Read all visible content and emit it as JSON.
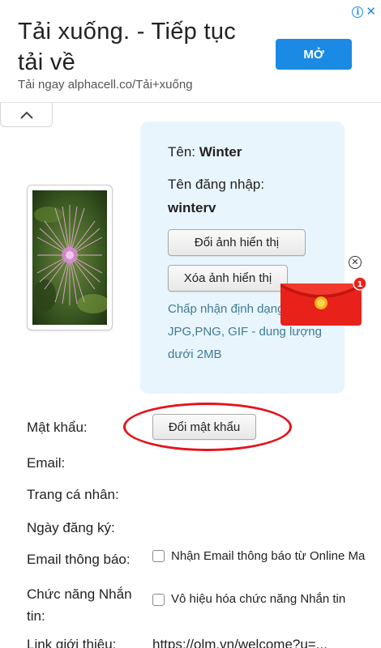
{
  "ad": {
    "title": "Tải xuống. - Tiếp tục tải về",
    "url": "Tải ngay alphacell.co/Tải+xuống",
    "button": "MỞ",
    "info_icon": "info-icon",
    "close_icon": "close-icon",
    "accent": "#1a8ae5"
  },
  "collapse": {
    "icon": "chevron-up-icon"
  },
  "profile": {
    "name_label": "Tên: ",
    "name_value": "Winter",
    "login_label": "Tên đăng nhập:",
    "login_value": "winterv",
    "change_avatar_button": "Đổi ảnh hiển thị",
    "delete_avatar_button": "Xóa ảnh hiển thị",
    "accept_text": "Chấp nhận định dạng JPG,PNG, GIF - dung lượng dưới 2MB",
    "panel_color": "#e9f5fc"
  },
  "floating": {
    "envelope_icon": "red-envelope-icon",
    "badge": "1",
    "close_icon": "close-circle-icon"
  },
  "form": {
    "password_label": "Mật khẩu:",
    "password_button": "Đổi mật khẩu",
    "email_label": "Email:",
    "homepage_label": "Trang cá nhân:",
    "register_label": "Ngày đăng ký:",
    "email_notify_label": "Email thông báo:",
    "email_notify_option": "Nhận Email thông báo từ Online Ma",
    "messaging_label": "Chức năng Nhắn tin:",
    "messaging_option": "Vô hiệu hóa chức năng Nhắn tin",
    "referral_label": "Link giới thiệu:",
    "referral_value": "https://olm.vn/welcome?u=..."
  },
  "annotation": {
    "color": "#e3141b"
  }
}
